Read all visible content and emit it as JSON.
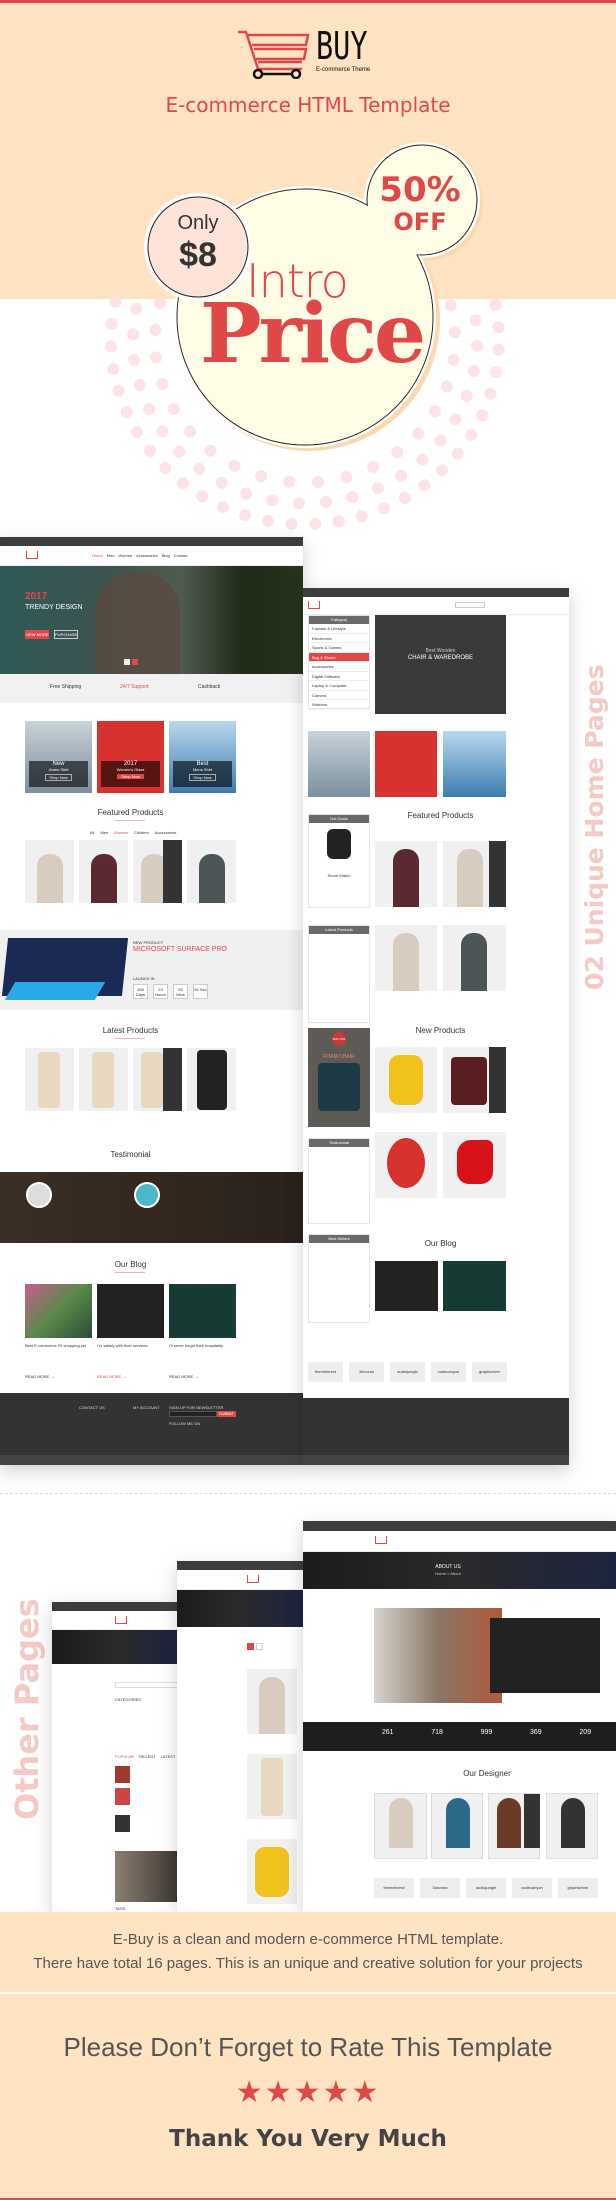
{
  "brand": {
    "logo_text": "BUY",
    "logo_tagline": "E-commerce Theme",
    "headline": "E-commerce HTML Template"
  },
  "promo": {
    "only": "Only",
    "price": "$8",
    "discount": "50%",
    "off": "OFF",
    "intro": "Intro",
    "price_word": "Price"
  },
  "sections": {
    "home_pages": "02 Unique Home Pages",
    "other_pages": "Other Pages"
  },
  "home1": {
    "nav": [
      "Home",
      "Men",
      "Women",
      "Accessories",
      "Blog",
      "Contact"
    ],
    "hero_year": "2017",
    "hero_title": "TRENDY DESIGN",
    "btn_view": "VIEW MORE",
    "btn_purchase": "PURCHASE",
    "features": [
      "Free Shipping",
      "24/7 Support",
      "Cashback"
    ],
    "banners": [
      {
        "title": "New",
        "sub": "Jeans Shirt"
      },
      {
        "title": "2017",
        "sub": "Women's Glass"
      },
      {
        "title": "Best",
        "sub": "Mens Shirt"
      }
    ],
    "shop_now": "Shop Now",
    "featured": "Featured Products",
    "tabs": [
      "All",
      "Men",
      "Women",
      "Children",
      "Accessories"
    ],
    "promo_kicker": "NEW PRODUCT",
    "promo_title": "MICROSOFT SURFACE PRO",
    "launch": "LAUNCH IN",
    "countdown": [
      "356 Days",
      "23 Hours",
      "55 Mins",
      "55 Sec"
    ],
    "latest": "Latest Products",
    "testimonial": "Testimonial",
    "blog": "Our Blog",
    "blog_titles": [
      "Best E-commerce Fit shopping yet",
      "I'm satisfy with their services",
      "I'll never forget their hospitality"
    ],
    "read_more": "READ MORE →",
    "footer_heads": [
      "CONTACT US",
      "MY ACCOUNT",
      "SIGN UP FOR NEWSLETTER"
    ],
    "subscribe": "SUBMIT",
    "follow": "FOLLOW ME ON"
  },
  "home2": {
    "category": "Category",
    "categories": [
      "Fashion & Lifestyle",
      "Electronics",
      "Sports & Games",
      "Bag & Shoes",
      "Accessories",
      "Digital Software",
      "Laptop & Computer",
      "Camera",
      "Watches"
    ],
    "slider_kicker": "Best Wooden",
    "slider_title": "CHAIR & WAREDROBE",
    "hot_deals": "Hot Deals",
    "smart_watch": "Smart Watch",
    "latest_products": "Latest Products",
    "featured": "Featured Products",
    "new_products": "New Products",
    "foam_off": "50% OFF",
    "foam_title": "FOAM CHAIR",
    "testimonial": "Testimonial",
    "best_sellers": "Best Sellers",
    "blog": "Our Blog"
  },
  "brands": [
    "themeforest",
    "3docean",
    "audiojungle",
    "codecanyon",
    "graphicriver"
  ],
  "other": {
    "about": "ABOUT US",
    "breadcrumb": "Home > About",
    "counters": [
      "261",
      "718",
      "999",
      "369",
      "209"
    ],
    "designer": "Our Designer",
    "categories_head": "CATEGORIES",
    "post_tabs": [
      "POPULAR",
      "RECENT",
      "LATEST"
    ],
    "tags": "TAGS"
  },
  "footer": {
    "desc1": "E-Buy is a clean and modern e-commerce HTML template.",
    "desc2": "There have total 16 pages. This is an unique and creative solution for your projects",
    "rate": "Please Don’t Forget to Rate This Template",
    "rating": 5,
    "thanks": "Thank You Very Much"
  },
  "colors": {
    "accent": "#e04848",
    "peach": "#fde3c2",
    "blob": "#fffde6",
    "dots": "#fbe3e6",
    "dark": "#333333"
  }
}
